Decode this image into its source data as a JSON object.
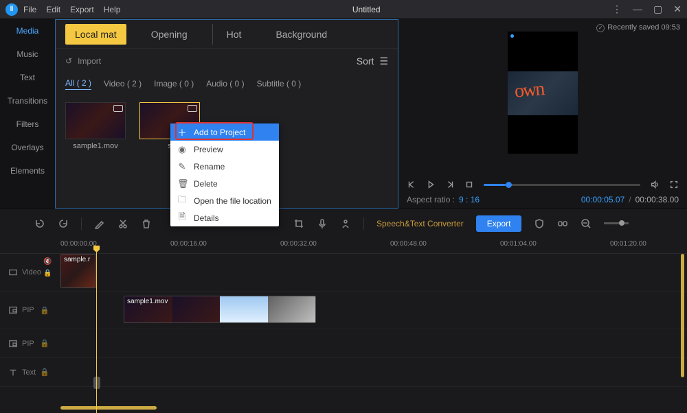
{
  "titlebar": {
    "menu": [
      "File",
      "Edit",
      "Export",
      "Help"
    ],
    "title": "Untitled"
  },
  "leftnav": [
    "Media",
    "Music",
    "Text",
    "Transitions",
    "Filters",
    "Overlays",
    "Elements"
  ],
  "media": {
    "tabs": [
      "Local mat",
      "Opening",
      "Hot",
      "Background"
    ],
    "import": "Import",
    "sort": "Sort",
    "filters": [
      "All ( 2 )",
      "Video ( 2 )",
      "Image ( 0 )",
      "Audio ( 0 )",
      "Subtitle ( 0 )"
    ],
    "items": [
      {
        "name": "sample1.mov"
      },
      {
        "name": "s"
      }
    ]
  },
  "context": [
    "Add to Project",
    "Preview",
    "Rename",
    "Delete",
    "Open the file location",
    "Details"
  ],
  "preview": {
    "saved": "Recently saved 09:53",
    "ratio_label": "Aspect ratio :",
    "ratio": "9 : 16",
    "time_cur": "00:00:05.07",
    "time_total": "00:00:38.00"
  },
  "toolbar": {
    "speech": "Speech&Text Converter",
    "export": "Export"
  },
  "timeline": {
    "ticks": [
      "00:00:00.00",
      "00:00:16.00",
      "00:00:32.00",
      "00:00:48.00",
      "00:01:04.00",
      "00:01:20.00"
    ],
    "tracks": {
      "video": "Video",
      "pip": "PIP",
      "pip2": "PIP",
      "text": "Text"
    },
    "clip_v": "sample.r",
    "clip_p": "sample1.mov"
  }
}
